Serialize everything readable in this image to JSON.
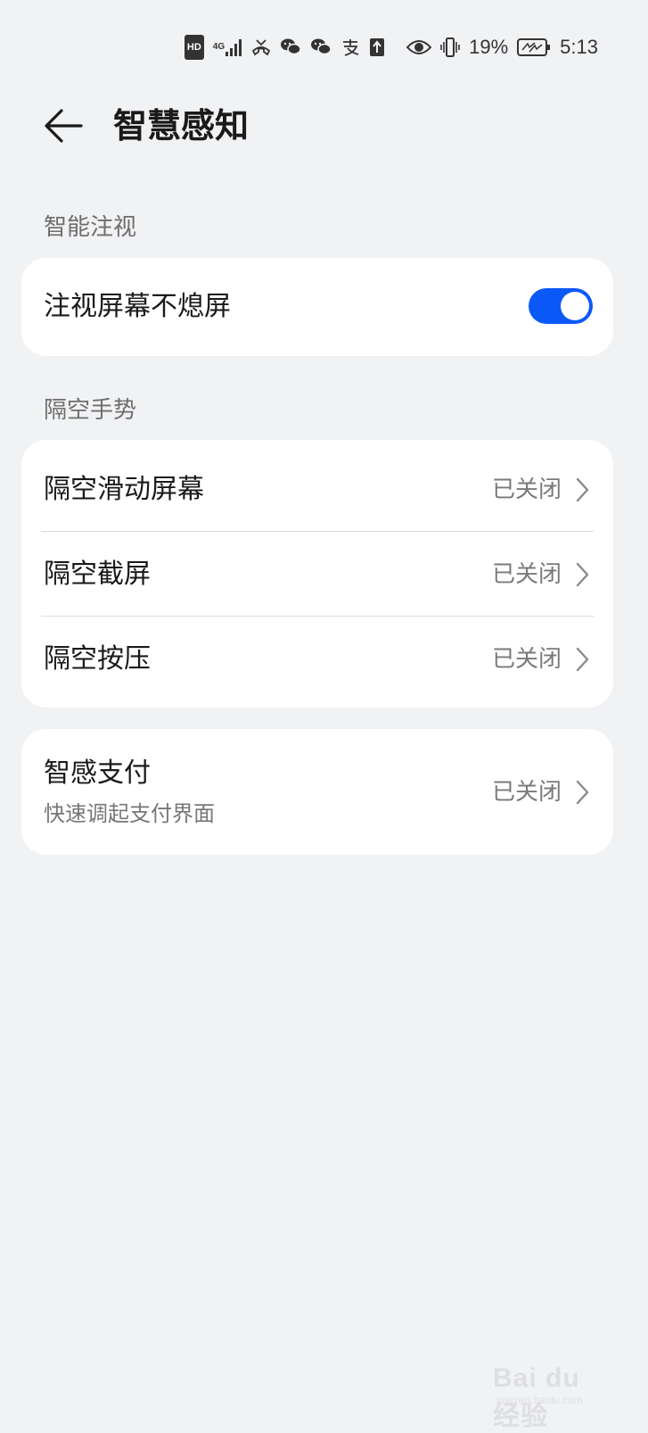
{
  "status_bar": {
    "hd": "HD",
    "network": "4G",
    "battery_percent": "19%",
    "time": "5:13",
    "icons": [
      "hd-icon",
      "signal-icon",
      "missed-call-icon",
      "wechat-icon",
      "wechat-icon",
      "alipay-icon",
      "upload-icon",
      "eye-icon",
      "vibrate-icon",
      "battery-charging-icon"
    ]
  },
  "header": {
    "title": "智慧感知",
    "back_icon": "back-arrow-icon"
  },
  "sections": {
    "gaze": {
      "header": "智能注视",
      "items": [
        {
          "label": "注视屏幕不熄屏",
          "toggle_on": true
        }
      ]
    },
    "air_gesture": {
      "header": "隔空手势",
      "items": [
        {
          "label": "隔空滑动屏幕",
          "status": "已关闭"
        },
        {
          "label": "隔空截屏",
          "status": "已关闭"
        },
        {
          "label": "隔空按压",
          "status": "已关闭"
        }
      ]
    },
    "payment": {
      "items": [
        {
          "label": "智感支付",
          "subtitle": "快速调起支付界面",
          "status": "已关闭"
        }
      ]
    }
  },
  "colors": {
    "background": "#f1f2f4",
    "card": "#ffffff",
    "accent": "#0a59f7",
    "text_primary": "#1a1a1a",
    "text_secondary": "#7a7a7a"
  },
  "watermark": {
    "brand": "Bai du 经验",
    "url": "jingyan.baidu.com"
  }
}
